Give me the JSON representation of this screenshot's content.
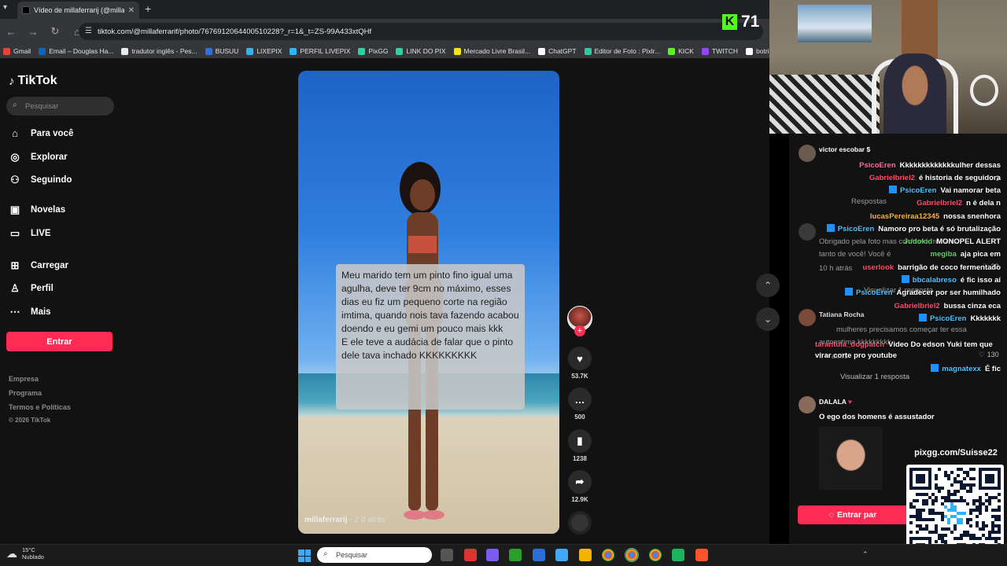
{
  "browser": {
    "tab_title": "Vídeo de millaferrarij (@millaferr",
    "url": "tiktok.com/@millaferrarif/photo/7676912064400510228?_r=1&_t=ZS-99A433xtQHf",
    "bookmarks": [
      {
        "label": "Gmail",
        "color": "#ea4335"
      },
      {
        "label": "Email – Douglas Ha...",
        "color": "#0a66c2"
      },
      {
        "label": "tradutor inglês - Pes...",
        "color": "#e8eaed"
      },
      {
        "label": "BUSUU",
        "color": "#2f6fe4"
      },
      {
        "label": "LIXEPIX",
        "color": "#2fb5f5"
      },
      {
        "label": "PERFIL LIVEPIX",
        "color": "#2fb5f5"
      },
      {
        "label": "PixGG",
        "color": "#27d3a0"
      },
      {
        "label": "LINK DO PIX",
        "color": "#27d3a0"
      },
      {
        "label": "Mercado Livre Brasil...",
        "color": "#ffe600"
      },
      {
        "label": "ChatGPT",
        "color": "#ffffff"
      },
      {
        "label": "Editor de Foto : Pixlr...",
        "color": "#30c8a0"
      },
      {
        "label": "KICK",
        "color": "#53fc18"
      },
      {
        "label": "TWITCH",
        "color": "#9146ff"
      },
      {
        "label": "botrix",
        "color": "#ffffff"
      }
    ]
  },
  "sidebar": {
    "logo": "TikTok",
    "search_placeholder": "Pesquisar",
    "items": [
      {
        "label": "Para você",
        "icon": "home-icon"
      },
      {
        "label": "Explorar",
        "icon": "compass-icon"
      },
      {
        "label": "Seguindo",
        "icon": "following-icon"
      },
      {
        "label": "Novelas",
        "icon": "novelas-icon"
      },
      {
        "label": "LIVE",
        "icon": "live-icon"
      },
      {
        "label": "Carregar",
        "icon": "upload-icon"
      },
      {
        "label": "Perfil",
        "icon": "profile-icon"
      },
      {
        "label": "Mais",
        "icon": "more-icon"
      }
    ],
    "login_button": "Entrar",
    "footer": [
      "Empresa",
      "Programa",
      "Termos e Políticas",
      "© 2026 TikTok"
    ]
  },
  "video": {
    "overlay_text_1": "Meu marido tem um pinto fino igual uma agulha, deve ter 9cm no máximo,  esses dias eu fiz um pequeno corte na região imtima, quando nois tava fazendo acabou doendo e eu gemi um pouco mais kkk",
    "overlay_text_2": "E ele teve a audácia de falar que o pinto dele tava inchado KKKKKKKKK",
    "author": "millaferrarij",
    "posted": "· 2 d atrás"
  },
  "actions": {
    "likes": "53.7K",
    "comments": "500",
    "saves": "1238",
    "shares": "12.9K"
  },
  "stream": {
    "viewer_count": "71",
    "kick_letter": "K",
    "qr_url": "pixgg.com/Suisse22",
    "chat_button": "Entrar par"
  },
  "comments_panel": {
    "c1_user": "victor escobar $",
    "c2_user": "lucasPereiraa12345",
    "c2_text": "nossa snenhora",
    "c3_user": "Tatiana Rocha",
    "c4_user": "DALALA",
    "c4_text": "O ego dos homens é assustador",
    "reply_label": "Visualizar 1 resposta",
    "likes_a": "3",
    "likes_b": "33",
    "likes_c": "130"
  },
  "chat_lines": [
    {
      "user": "PsicoEren",
      "text": "Kkkkkkkkkkkkkulher dessas",
      "ucolor": "#ff6fa0"
    },
    {
      "user": "Gabrielbriel2",
      "text": "é historia de seguidora",
      "ucolor": "#ff4f6f"
    },
    {
      "user": "PsicoEren",
      "text": "Vai namorar beta",
      "ucolor": "#4fc3ff"
    },
    {
      "user": "Gabrielbriel2",
      "text": "n é dela n",
      "ucolor": "#ff4f6f"
    },
    {
      "user": "lucasPereiraa12345",
      "text": "nossa snenhora",
      "ucolor": "#ffb347"
    },
    {
      "user": "PsicoEren",
      "text": "Namoro pro beta é só brutalização",
      "ucolor": "#4fc3ff"
    },
    {
      "user": "Judokid",
      "text": "MONOPEL ALERT",
      "ucolor": "#5fd35f"
    },
    {
      "user": "megiba",
      "text": "aja pica em",
      "ucolor": "#5fd35f"
    },
    {
      "user": "userlook",
      "text": "barrigão de coco fermentado",
      "ucolor": "#ff4f6f"
    },
    {
      "user": "bbcalabreso",
      "text": "é fic isso aí",
      "ucolor": "#4fc3ff"
    },
    {
      "user": "PsicoEren",
      "text": "Agradecer por ser humilhado",
      "ucolor": "#4fc3ff"
    },
    {
      "user": "Gabrielbriel2",
      "text": "bussa cinza eca",
      "ucolor": "#ff4f6f"
    },
    {
      "user": "PsicoEren",
      "text": "Kkkkkkk",
      "ucolor": "#4fc3ff"
    },
    {
      "user": "tarantula_dogpatch",
      "text": "Video Do edson Yuki tem que virar corte pro youtube",
      "ucolor": "#ff4f6f"
    },
    {
      "user": "magnatexx",
      "text": "É fic",
      "ucolor": "#4fc3ff"
    }
  ],
  "ghost_lines": [
    "Respostas",
    "Visualizar 1 resposta",
    "mulheres precisamos começar ter essa",
    "autoestima kkkkkkkkk",
    "9 h atrás",
    "Obrigado pela foto mas confesso, reclamo",
    "tanto de você! Você é",
    "10 h atrás"
  ],
  "taskbar": {
    "temp": "15°C",
    "weather": "Nublado",
    "search_placeholder": "Pesquisar"
  }
}
